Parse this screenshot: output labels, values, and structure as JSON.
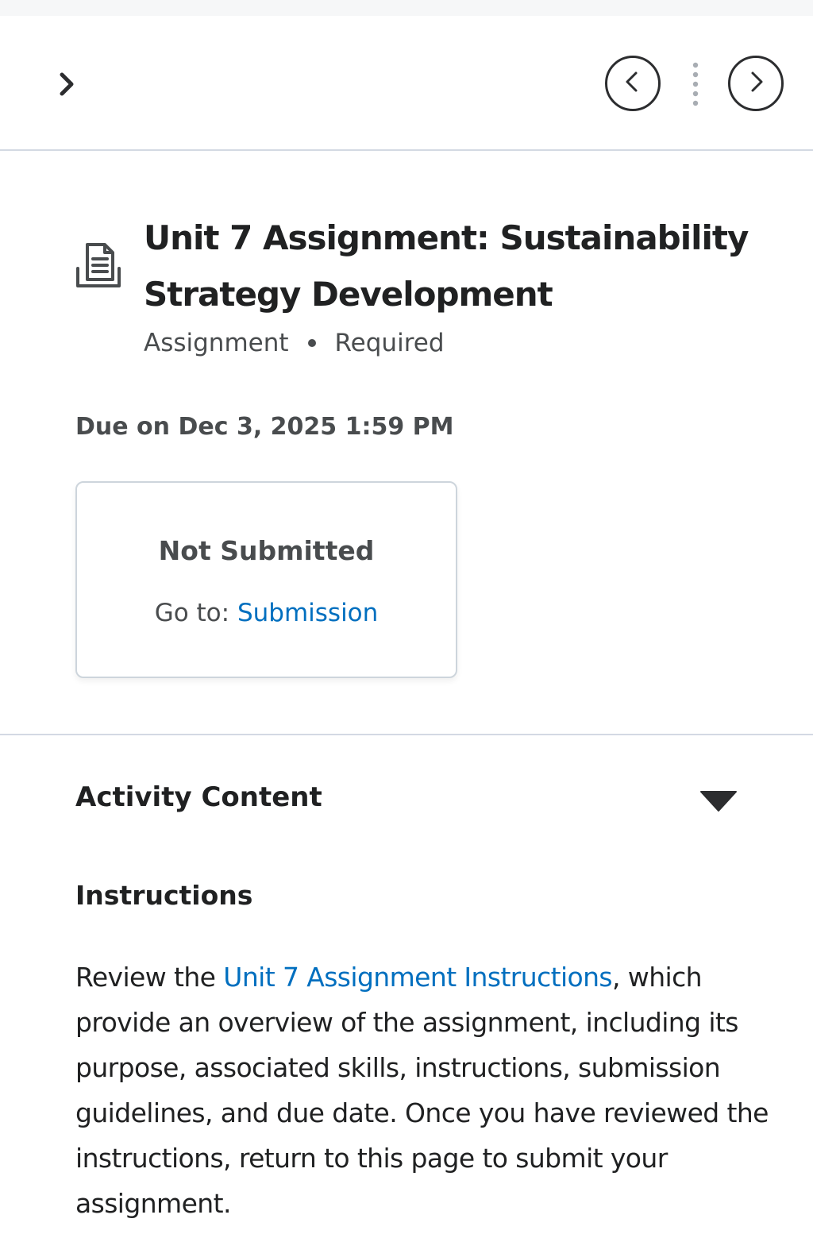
{
  "topbar": {
    "expand_icon": "chevron-right-icon",
    "prev_icon": "chevron-left-circle-icon",
    "divider_icon": "vertical-dots-icon",
    "next_icon": "chevron-right-circle-icon"
  },
  "activity": {
    "icon": "assignment-document-icon",
    "title": "Unit 7 Assignment: Sustainability Strategy Development",
    "type_label": "Assignment",
    "required_label": "Required",
    "due_text": "Due on Dec 3, 2025 1:59 PM"
  },
  "status_card": {
    "status": "Not Submitted",
    "goto_prefix": "Go to: ",
    "goto_link": "Submission"
  },
  "content_section": {
    "header": "Activity Content",
    "toggle_icon": "caret-down-icon",
    "instructions_heading": "Instructions",
    "body_prefix": "Review the ",
    "body_link": "Unit 7 Assignment Instructions",
    "body_suffix": ", which provide an overview of the assignment, including its purpose, associated skills, instructions, submission guidelines, and due date. Once you have reviewed the instructions, return to this page to submit your assignment."
  },
  "colors": {
    "link": "#006fbf",
    "text_primary": "#202122",
    "text_secondary": "#494c4e",
    "divider": "#d3d9e3"
  }
}
